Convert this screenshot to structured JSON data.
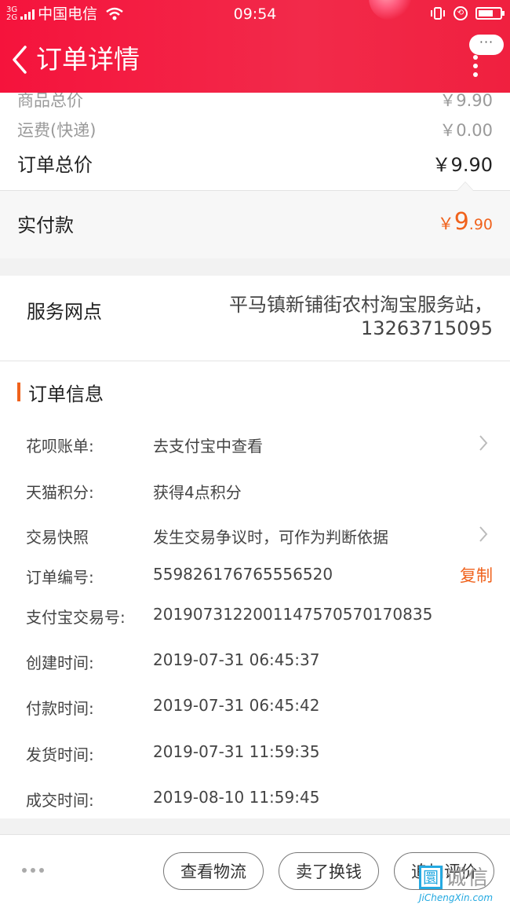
{
  "status_bar": {
    "network_top": "3G",
    "network_bottom": "2G",
    "carrier": "中国电信",
    "time": "09:54",
    "battery_level": 0.7
  },
  "header": {
    "title": "订单详情",
    "more_button": "···"
  },
  "price_summary": {
    "goods_total_label": "商品总价",
    "goods_total_value": "￥9.90",
    "shipping_label": "运费(快递)",
    "shipping_value": "￥0.00",
    "order_total_label": "订单总价",
    "order_total_value": "￥9.90",
    "paid_label": "实付款",
    "paid_symbol": "￥",
    "paid_integer": "9",
    "paid_decimal": ".90"
  },
  "service": {
    "label": "服务网点",
    "value_line1": "平马镇新铺街农村淘宝服务站，",
    "value_line2": "13263715095"
  },
  "order_info": {
    "heading": "订单信息",
    "rows": [
      {
        "key": "花呗账单:",
        "value": "去支付宝中查看"
      },
      {
        "key": "天猫积分:",
        "value": "获得4点积分"
      },
      {
        "key": "交易快照",
        "value": "发生交易争议时，可作为判断依据"
      },
      {
        "key": "订单编号:",
        "value": "559826176765556520",
        "action": "复制"
      },
      {
        "key": "支付宝交易号:",
        "value": "2019073122001147570570170835"
      },
      {
        "key": "创建时间:",
        "value": "2019-07-31 06:45:37"
      },
      {
        "key": "付款时间:",
        "value": "2019-07-31 06:45:42"
      },
      {
        "key": "发货时间:",
        "value": "2019-07-31 11:59:35"
      },
      {
        "key": "成交时间:",
        "value": "2019-08-10 11:59:45"
      }
    ]
  },
  "bottom_bar": {
    "buttons": [
      "查看物流",
      "卖了换钱",
      "追加评价"
    ]
  },
  "watermark": {
    "logo_char": "圜",
    "word": "诚信",
    "url": "JiChengXin.com"
  },
  "colors": {
    "header_red": "#f5133c",
    "accent_orange": "#f0621c"
  }
}
